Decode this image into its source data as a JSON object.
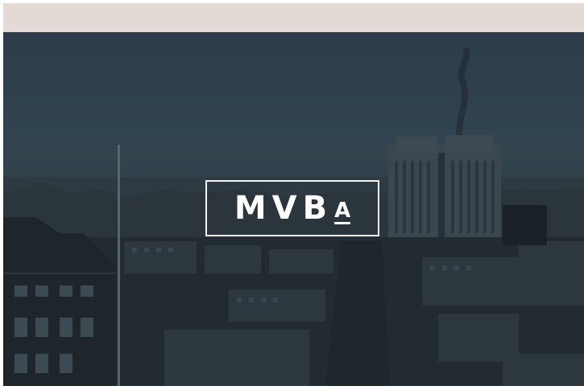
{
  "header": {
    "color": "#e3dad5"
  },
  "hero": {
    "image_description_icon": "city-skyline-photo",
    "tint_color": "#2f3d47"
  },
  "logo": {
    "main": "MVB",
    "sub": "A",
    "color": "#ffffff"
  }
}
